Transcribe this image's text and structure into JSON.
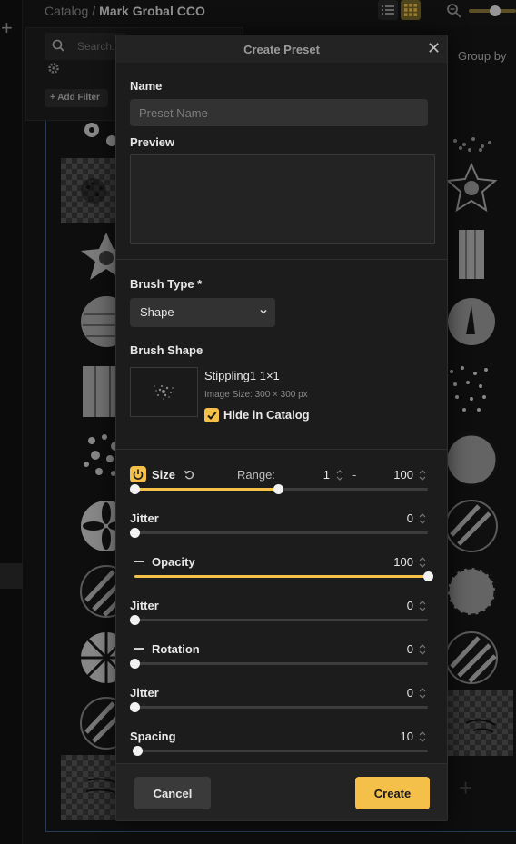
{
  "breadcrumb": {
    "root": "Catalog",
    "separator": "/",
    "current": "Mark Grobal CCO"
  },
  "filters": {
    "search_placeholder": "Search...",
    "add_filter_label": "+ Add Filter",
    "group_by_label": "Group by"
  },
  "zoom": {
    "level": 0.55
  },
  "modal": {
    "title": "Create Preset",
    "name_label": "Name",
    "name_placeholder": "Preset Name",
    "preview_label": "Preview",
    "brush_type_label": "Brush Type *",
    "brush_type_value": "Shape",
    "brush_shape_label": "Brush Shape",
    "shape_name": "Stippling1 1×1",
    "image_size": "Image Size: 300 × 300 px",
    "hide_in_catalog_label": "Hide in Catalog",
    "hide_in_catalog": true,
    "size": {
      "label": "Size",
      "range_label": "Range:",
      "min": "1",
      "dash": "-",
      "max": "100",
      "slider_start": 0.0,
      "slider_end": 0.49
    },
    "size_jitter": {
      "label": "Jitter",
      "value": "0",
      "slider": 0.0
    },
    "opacity": {
      "label": "Opacity",
      "value": "100",
      "slider": 1.0
    },
    "opacity_jitter": {
      "label": "Jitter",
      "value": "0",
      "slider": 0.0
    },
    "rotation": {
      "label": "Rotation",
      "value": "0",
      "slider": 0.0
    },
    "rotation_jitter": {
      "label": "Jitter",
      "value": "0",
      "slider": 0.0
    },
    "spacing": {
      "label": "Spacing",
      "value": "10",
      "slider": 0.01
    },
    "cancel_label": "Cancel",
    "create_label": "Create"
  },
  "colors": {
    "accent": "#f5c04a",
    "background": "#161616",
    "modal": "#1c1c1c",
    "selection_border": "#3a5b85"
  }
}
